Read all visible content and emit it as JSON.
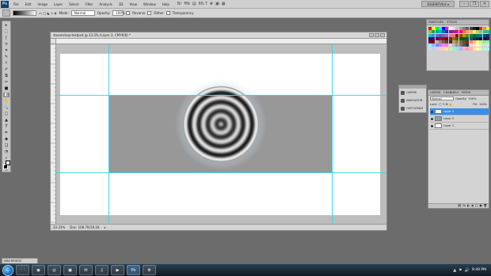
{
  "menubar": {
    "logo": "Ps",
    "items": [
      "File",
      "Edit",
      "Image",
      "Layer",
      "Select",
      "Filter",
      "Analysis",
      "3D",
      "View",
      "Window",
      "Help"
    ],
    "icons": [
      "Br",
      "Mb",
      "▤",
      "66.7",
      "✥",
      "▣",
      "▦"
    ],
    "workspace": "ESSENTIALS ▾",
    "win_controls": [
      "–",
      "❐",
      "✕"
    ]
  },
  "options": {
    "mode_label": "Mode:",
    "mode_value": "Normal",
    "opacity_label": "Opacity:",
    "opacity_value": "100%",
    "reverse_label": "Reverse",
    "dither_label": "Dither",
    "transparency_label": "Transparency"
  },
  "tools": [
    "▸",
    "⬚",
    "ʃ",
    "⟡",
    "⌗",
    "✎",
    "⚕",
    "✐",
    "⧉",
    "✂",
    "■",
    "◧",
    "✋",
    "🔍",
    "▢",
    "▲",
    "T",
    "✒",
    "◆",
    "❏",
    "◔",
    "⌕",
    "◎"
  ],
  "document": {
    "title": "steamshop-testpsd @ 33.3% (Layer 3, CMYK/8) *",
    "zoom": "33.33%",
    "doc_size": "Doc: 106.7K/16.1K"
  },
  "swatches": {
    "tabs": [
      "SWATCHES",
      "STYLES"
    ],
    "colors": [
      "#ff0000",
      "#ffff00",
      "#00ff00",
      "#00ffff",
      "#0000ff",
      "#ff00ff",
      "#ffffff",
      "#e0e0e0",
      "#c0c0c0",
      "#a0a0a0",
      "#808080",
      "#606060",
      "#404040",
      "#202020",
      "#000000",
      "#ed1c24",
      "#f7941d",
      "#fff200",
      "#8dc63f",
      "#00a651",
      "#00a99d",
      "#00aeef",
      "#0072bc",
      "#2e3192",
      "#662d91",
      "#92278f",
      "#ec008c",
      "#ed145b",
      "#f26c4f",
      "#f69679",
      "#fbaf5d",
      "#fff568",
      "#acd373",
      "#7cc576",
      "#3bb878",
      "#1abbb4",
      "#00bff3",
      "#438ccb",
      "#5574b9",
      "#605ca8",
      "#855fa8",
      "#a763a9",
      "#f06eaa",
      "#f06d79",
      "#9e0b0f",
      "#a0410d",
      "#aba000",
      "#598527",
      "#197b30",
      "#007236",
      "#00746b",
      "#0076a3",
      "#004b80",
      "#003471",
      "#1b1464",
      "#440e62",
      "#630460",
      "#9e005d",
      "#9e0039",
      "#790000",
      "#7b2e00",
      "#827b00",
      "#406618",
      "#005e20",
      "#005826",
      "#005952",
      "#005b7f",
      "#003663",
      "#002157",
      "#0d004c",
      "#32004b",
      "#4b0049",
      "#7b0046",
      "#7a0026",
      "#c7b299",
      "#998675",
      "#736357",
      "#534741",
      "#37302a",
      "#c69c6d",
      "#a67c52",
      "#8c6239",
      "#754c24",
      "#603913",
      "#ff8080",
      "#ffc080",
      "#ffff80",
      "#c0ff80",
      "#80ff80",
      "#80ffc0",
      "#80ffff",
      "#80c0ff",
      "#8080ff",
      "#c080ff",
      "#ff80ff",
      "#ff80c0",
      "#d8d8d8",
      "#b8b8b8",
      "#989898",
      "#787878",
      "#585858",
      "#383838",
      "#f9cbd1",
      "#fde3c6",
      "#fffbc2",
      "#e2f0c8",
      "#c9e8cf",
      "#c6e9ef",
      "#c4dcf3",
      "#ccc9e6",
      "#e6c9e4",
      "#f8c8dc",
      "#ffd7a8",
      "#ffe8a0",
      "#ccf0a0",
      "#a0f0cc",
      "#a0dcf0",
      "#b0b0f0",
      "#f0b0e0",
      "#f0a0a0",
      "#ffb0b0",
      "#ffe0b0",
      "#ffffb0",
      "#d8ffb0",
      "#b0ffd8",
      "#b0f0ff"
    ]
  },
  "dock": {
    "items": [
      "LAYERS",
      "NAVIGATOR",
      "HISTOGRAM"
    ]
  },
  "layers": {
    "tabs": [
      "LAYERS",
      "CHANNELS",
      "PATHS"
    ],
    "blend": "Normal",
    "opacity_label": "Opacity:",
    "opacity_value": "100%",
    "lock_label": "Lock:",
    "fill_label": "Fill:",
    "fill_value": "100%",
    "items": [
      "Layer 3",
      "Layer 2",
      "Layer 1"
    ],
    "footer_icons": [
      "⛓",
      "fx",
      "◐",
      "◑",
      "▢",
      "▣",
      "🗑"
    ]
  },
  "mini_bridge": "MINI BRIDGE",
  "taskbar": {
    "apps": [
      "🗀",
      "◉",
      "◎",
      "▣",
      "✉",
      "♫",
      "▶",
      "Ps",
      "⚙"
    ],
    "tray": [
      "▲",
      "⚑",
      "🔊"
    ],
    "time": "9:49 PM"
  }
}
